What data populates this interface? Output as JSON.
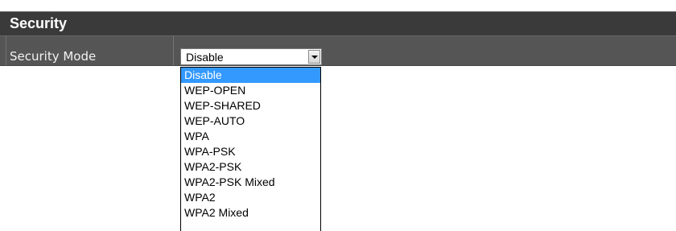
{
  "section": {
    "title": "Security"
  },
  "security_mode": {
    "label": "Security Mode",
    "selected_value": "Disable",
    "options": [
      "Disable",
      "WEP-OPEN",
      "WEP-SHARED",
      "WEP-AUTO",
      "WPA",
      "WPA-PSK",
      "WPA2-PSK",
      "WPA2-PSK Mixed",
      "WPA2",
      "WPA2 Mixed"
    ],
    "highlighted_option": "Disable"
  },
  "colors": {
    "header_bg": "#3a3a3a",
    "row_bg": "#555555",
    "highlight": "#3399ff"
  },
  "icons": {
    "dropdown_arrow": "chevron-down-icon"
  }
}
